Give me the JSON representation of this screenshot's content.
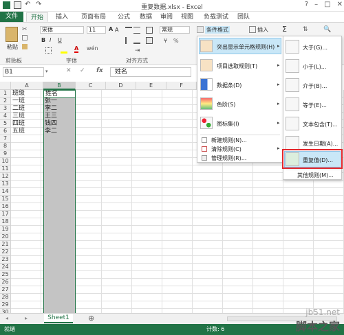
{
  "window": {
    "title": "重复数据.xlsx - Excel"
  },
  "tabs": [
    "文件",
    "开始",
    "插入",
    "页面布局",
    "公式",
    "数据",
    "审阅",
    "视图",
    "负载测试",
    "团队"
  ],
  "ribbon": {
    "paste_label": "粘贴",
    "clipboard_label": "剪贴板",
    "font_name": "宋体",
    "font_size": "11",
    "font_group_label": "字体",
    "align_group_label": "对齐方式",
    "number_format": "常规",
    "conditional_format_label": "条件格式",
    "insert_label": "插入",
    "sum_symbol": "Σ"
  },
  "formula_bar": {
    "name_box": "B1",
    "fx": "fx",
    "value": "姓名"
  },
  "columns": [
    "A",
    "B",
    "C",
    "D",
    "E",
    "F"
  ],
  "rows": [
    "1",
    "2",
    "3",
    "4",
    "5",
    "6",
    "7",
    "8",
    "9",
    "10",
    "11",
    "12",
    "13",
    "14",
    "15",
    "16",
    "17",
    "18",
    "19",
    "20",
    "21",
    "22",
    "23",
    "24",
    "25",
    "26",
    "27",
    "28",
    "29",
    "30"
  ],
  "cells": {
    "A": [
      "班级",
      "一班",
      "二班",
      "三班",
      "四班",
      "五班"
    ],
    "B": [
      "姓名",
      "张一",
      "李二",
      "王三",
      "钱四",
      "李二"
    ]
  },
  "conditional_menu": {
    "items": [
      {
        "label": "突出显示单元格规则(H)",
        "icon": "highlight-rules-icon"
      },
      {
        "label": "项目选取规则(T)",
        "icon": "top-bottom-icon"
      },
      {
        "label": "数据条(D)",
        "icon": "databar-icon"
      },
      {
        "label": "色阶(S)",
        "icon": "colorscale-icon"
      },
      {
        "label": "图标集(I)",
        "icon": "iconset-icon"
      }
    ],
    "small_items": [
      "新建规则(N)...",
      "清除规则(C)",
      "管理规则(R)..."
    ]
  },
  "submenu": {
    "items": [
      "大于(G)...",
      "小于(L)...",
      "介于(B)...",
      "等于(E)...",
      "文本包含(T)...",
      "发生日期(A)...",
      "重复值(D)..."
    ],
    "more": "其他规则(M)..."
  },
  "sheet": {
    "tab": "Sheet1"
  },
  "status": {
    "ready": "就绪",
    "count": "计数: 6"
  },
  "watermark": {
    "line1": "jb51.net",
    "line2": "脚本之家"
  },
  "colors": {
    "excel_green": "#217346",
    "highlight": "#c9e7f7",
    "red_border": "#e3262b"
  }
}
